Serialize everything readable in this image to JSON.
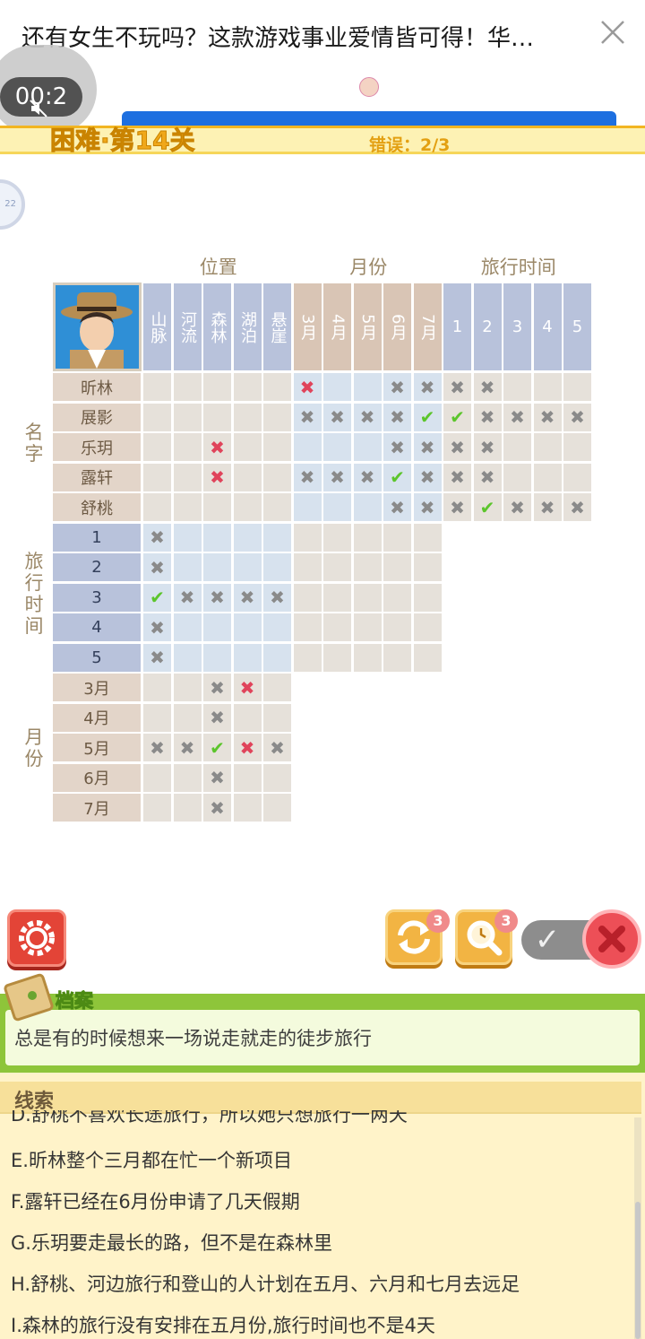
{
  "header": {
    "ad_title": "还有女生不玩吗？这款游戏事业爱情皆可得！华…",
    "video_time": "00:2"
  },
  "level": {
    "title": "困难·第14关",
    "errors": "错误：2/3"
  },
  "grid": {
    "group_labels": {
      "position": "位置",
      "month": "月份",
      "trip": "旅行时间"
    },
    "position_cols": [
      "山脉",
      "河流",
      "森林",
      "湖泊",
      "悬崖"
    ],
    "month_cols": [
      "3月",
      "4月",
      "5月",
      "6月",
      "7月"
    ],
    "trip_cols": [
      "1",
      "2",
      "3",
      "4",
      "5"
    ],
    "side_labels": {
      "name": "名字",
      "trip": "旅行时间",
      "month": "月份"
    },
    "name_rows": [
      "昕林",
      "展影",
      "乐玥",
      "露轩",
      "舒桃"
    ],
    "trip_rows": [
      "1",
      "2",
      "3",
      "4",
      "5"
    ],
    "month_rows": [
      "3月",
      "4月",
      "5月",
      "6月",
      "7月"
    ],
    "marks": {
      "name_position": [
        [
          "",
          "",
          "",
          "",
          ""
        ],
        [
          "",
          "",
          "",
          "",
          ""
        ],
        [
          "",
          "",
          "r",
          "",
          ""
        ],
        [
          "",
          "",
          "r",
          "",
          ""
        ],
        [
          "",
          "",
          "",
          "",
          ""
        ]
      ],
      "name_month": [
        [
          "r",
          "",
          "",
          "x",
          "x"
        ],
        [
          "x",
          "x",
          "x",
          "x",
          "v"
        ],
        [
          "",
          "",
          "",
          "x",
          "x"
        ],
        [
          "x",
          "x",
          "x",
          "v",
          "x"
        ],
        [
          "",
          "",
          "",
          "x",
          "x"
        ]
      ],
      "name_trip": [
        [
          "x",
          "x",
          "",
          "",
          ""
        ],
        [
          "v",
          "x",
          "x",
          "x",
          "x"
        ],
        [
          "x",
          "x",
          "",
          "",
          ""
        ],
        [
          "x",
          "x",
          "",
          "",
          ""
        ],
        [
          "x",
          "v",
          "x",
          "x",
          "x"
        ]
      ],
      "trip_position": [
        [
          "x",
          "",
          "",
          "",
          ""
        ],
        [
          "x",
          "",
          "",
          "",
          ""
        ],
        [
          "v",
          "x",
          "x",
          "x",
          "x"
        ],
        [
          "x",
          "",
          "",
          "",
          ""
        ],
        [
          "x",
          "",
          "",
          "",
          ""
        ]
      ],
      "trip_month": [
        [
          "",
          "",
          "",
          "",
          ""
        ],
        [
          "",
          "",
          "",
          "",
          ""
        ],
        [
          "",
          "",
          "",
          "",
          ""
        ],
        [
          "",
          "",
          "",
          "",
          ""
        ],
        [
          "",
          "",
          "",
          "",
          ""
        ]
      ],
      "month_position": [
        [
          "",
          "",
          "x",
          "r",
          ""
        ],
        [
          "",
          "",
          "x",
          "",
          ""
        ],
        [
          "x",
          "x",
          "v",
          "r",
          "x"
        ],
        [
          "",
          "",
          "x",
          "",
          ""
        ],
        [
          "",
          "",
          "x",
          "",
          ""
        ]
      ]
    }
  },
  "toolbar": {
    "reset_count": "3",
    "hint_count": "3",
    "toggle_mark": "✓"
  },
  "archive": {
    "label": "档案",
    "text": "总是有的时候想来一场说走就走的徒步旅行"
  },
  "clues": {
    "title": "线索",
    "items": [
      "D.舒桃不喜欢长途旅行，所以她只想旅行一两天",
      "E.昕林整个三月都在忙一个新项目",
      "F.露轩已经在6月份申请了几天假期",
      "G.乐玥要走最长的路，但不是在森林里",
      "H.舒桃、河边旅行和登山的人计划在五月、六月和七月去远足",
      "I.森林的旅行没有安排在五月份,旅行时间也不是4天"
    ]
  },
  "colors": {
    "level_gold": "#f0a81a",
    "mark_red": "#e0445b",
    "mark_green": "#5cc52c",
    "mark_gray": "#8a8a8a",
    "archive_green": "#8ec53a"
  }
}
